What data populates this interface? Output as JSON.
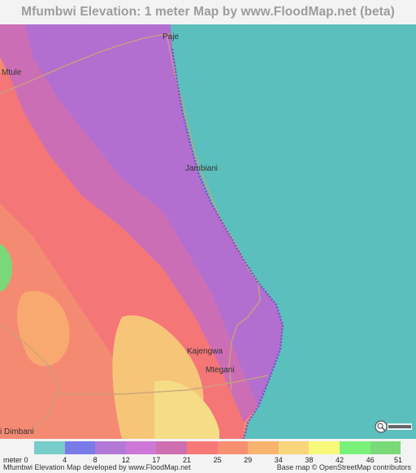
{
  "title": "Mfumbwi Elevation: 1 meter Map by www.FloodMap.net (beta)",
  "map": {
    "places": [
      {
        "name": "Paje"
      },
      {
        "name": "Mtule"
      },
      {
        "name": "Jambiani"
      },
      {
        "name": "Kajengwa"
      },
      {
        "name": "Mtegani"
      },
      {
        "name": "i Dimbani"
      }
    ],
    "osm_badge": "OpenStreetMap logo"
  },
  "legend": {
    "unit_label": "meter 0",
    "items": [
      {
        "value": "4",
        "color": "#76cdc9"
      },
      {
        "value": "8",
        "color": "#7a7ae8"
      },
      {
        "value": "12",
        "color": "#b178d8"
      },
      {
        "value": "17",
        "color": "#cd78d8"
      },
      {
        "value": "21",
        "color": "#cd6fb1"
      },
      {
        "value": "25",
        "color": "#f87878"
      },
      {
        "value": "29",
        "color": "#f79071"
      },
      {
        "value": "34",
        "color": "#f8b46e"
      },
      {
        "value": "38",
        "color": "#f8d57a"
      },
      {
        "value": "42",
        "color": "#f8f87a"
      },
      {
        "value": "46",
        "color": "#7af27a"
      },
      {
        "value": "51",
        "color": "#7ada7a"
      }
    ]
  },
  "footer": {
    "left": "Mfumbwi Elevation Map developed by www.FloodMap.net",
    "right": "Base map © OpenStreetMap contributors"
  }
}
